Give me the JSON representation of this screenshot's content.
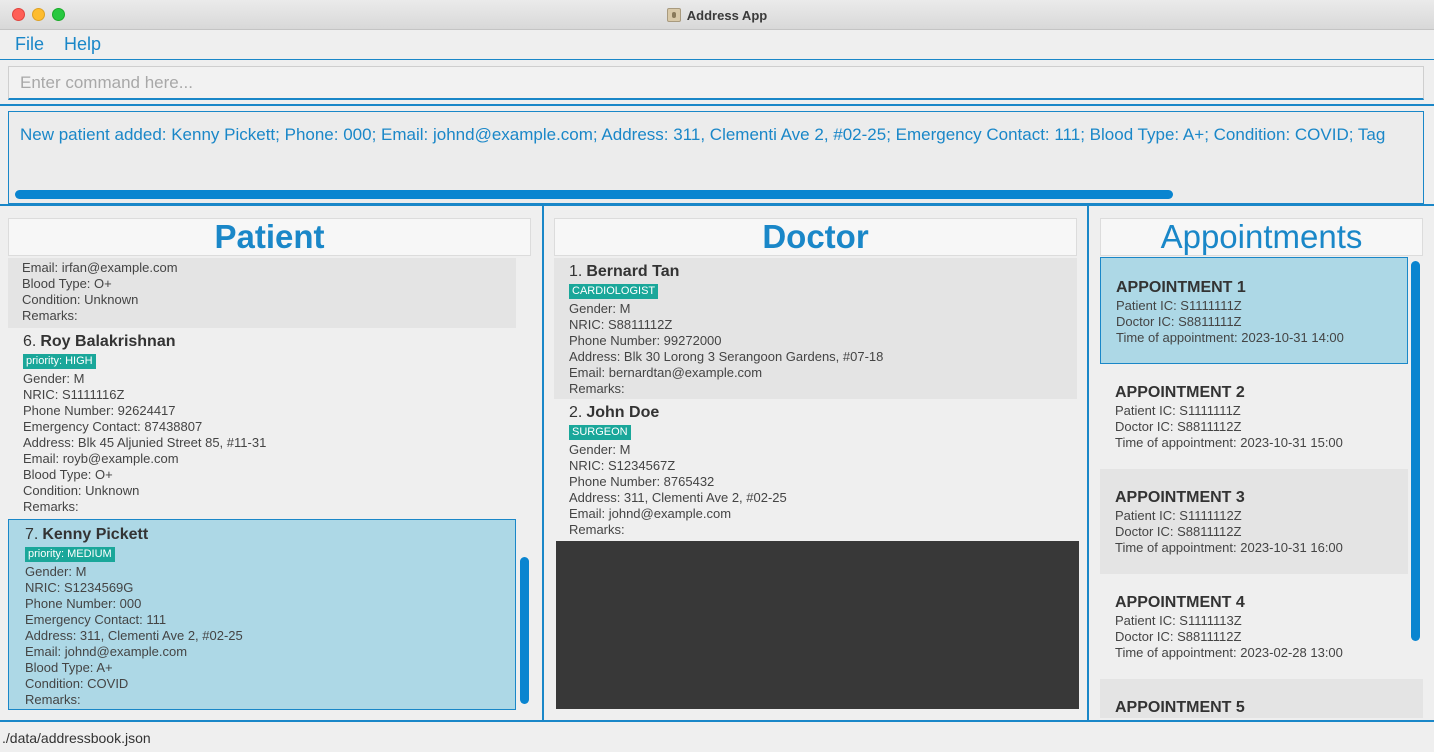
{
  "window": {
    "title": "Address App"
  },
  "menu": {
    "file": "File",
    "help": "Help"
  },
  "command": {
    "placeholder": "Enter command here..."
  },
  "result": {
    "text": "New patient added: Kenny Pickett; Phone: 000; Email: johnd@example.com; Address: 311, Clementi Ave 2, #02-25; Emergency Contact: 111; Blood Type: A+; Condition: COVID; Tag"
  },
  "patient_panel": {
    "header": "Patient",
    "partial_card": {
      "email": "Email: irfan@example.com",
      "blood": "Blood Type: O+",
      "condition": "Condition: Unknown",
      "remarks": "Remarks:"
    },
    "cards": [
      {
        "index": "6.",
        "name": "Roy Balakrishnan",
        "tag": "priority: HIGH",
        "gender": "Gender: M",
        "nric": "NRIC: S1111116Z",
        "phone": "Phone Number: 92624417",
        "emergency": "Emergency Contact: 87438807",
        "address": "Address: Blk 45 Aljunied Street 85, #11-31",
        "email": "Email: royb@example.com",
        "blood": "Blood Type: O+",
        "condition": "Condition: Unknown",
        "remarks": "Remarks:"
      },
      {
        "index": "7.",
        "name": "Kenny Pickett",
        "tag": "priority: MEDIUM",
        "gender": "Gender: M",
        "nric": "NRIC: S1234569G",
        "phone": "Phone Number: 000",
        "emergency": "Emergency Contact: 111",
        "address": "Address: 311, Clementi Ave 2, #02-25",
        "email": "Email: johnd@example.com",
        "blood": "Blood Type: A+",
        "condition": "Condition: COVID",
        "remarks": "Remarks:"
      }
    ]
  },
  "doctor_panel": {
    "header": "Doctor",
    "cards": [
      {
        "index": "1.",
        "name": "Bernard Tan",
        "tag": "CARDIOLOGIST",
        "gender": "Gender: M",
        "nric": "NRIC: S8811112Z",
        "phone": "Phone Number: 99272000",
        "address": "Address: Blk 30 Lorong 3 Serangoon Gardens, #07-18",
        "email": "Email: bernardtan@example.com",
        "remarks": "Remarks:"
      },
      {
        "index": "2.",
        "name": "John Doe",
        "tag": "SURGEON",
        "gender": "Gender: M",
        "nric": "NRIC: S1234567Z",
        "phone": "Phone Number: 8765432",
        "address": "Address: 311, Clementi Ave 2, #02-25",
        "email": "Email: johnd@example.com",
        "remarks": "Remarks:"
      }
    ]
  },
  "appointment_panel": {
    "header": "Appointments",
    "cards": [
      {
        "title": "APPOINTMENT 1",
        "patient": "Patient IC: S1111111Z",
        "doctor": "Doctor IC: S8811111Z",
        "time": "Time of appointment: 2023-10-31 14:00"
      },
      {
        "title": "APPOINTMENT 2",
        "patient": "Patient IC: S1111111Z",
        "doctor": "Doctor IC: S8811112Z",
        "time": "Time of appointment: 2023-10-31 15:00"
      },
      {
        "title": "APPOINTMENT 3",
        "patient": "Patient IC: S1111112Z",
        "doctor": "Doctor IC: S8811112Z",
        "time": "Time of appointment: 2023-10-31 16:00"
      },
      {
        "title": "APPOINTMENT 4",
        "patient": "Patient IC: S1111113Z",
        "doctor": "Doctor IC: S8811112Z",
        "time": "Time of appointment: 2023-02-28 13:00"
      },
      {
        "title": "APPOINTMENT 5"
      }
    ]
  },
  "status": {
    "path": "./data/addressbook.json"
  }
}
